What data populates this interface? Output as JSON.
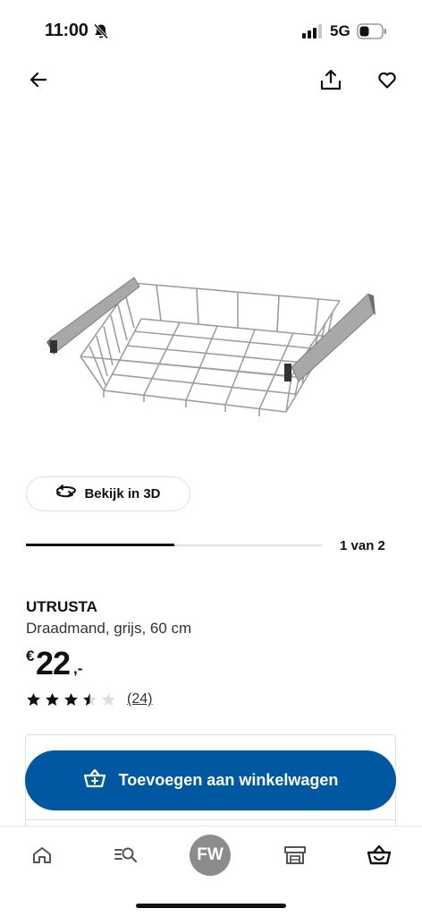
{
  "status_bar": {
    "time": "11:00",
    "network": "5G",
    "icons": [
      "bell-slash-icon",
      "signal-icon",
      "battery-icon"
    ]
  },
  "header": {
    "icons": [
      "arrow-left-icon",
      "share-icon",
      "heart-icon"
    ]
  },
  "gallery": {
    "view_3d_label": "Bekijk in 3D",
    "counter": "1 van 2",
    "progress": 0.5
  },
  "product": {
    "name": "UTRUSTA",
    "description": "Draadmand, grijs, 60 cm",
    "price_currency": "€",
    "price_amount": "22",
    "price_suffix": ",-",
    "rating": 3.5,
    "rating_max": 5,
    "review_count": "(24)"
  },
  "cart": {
    "add_label": "Toevoegen aan winkelwagen"
  },
  "bottom_nav": {
    "avatar_initials": "FW",
    "icons": [
      "home-icon",
      "search-list-icon",
      "store-icon",
      "basket-icon"
    ]
  },
  "colors": {
    "brand_blue": "#0058a3",
    "avatar_gray": "#8c8c8c",
    "star_filled": "#111111",
    "star_empty": "#dfdfdf"
  }
}
